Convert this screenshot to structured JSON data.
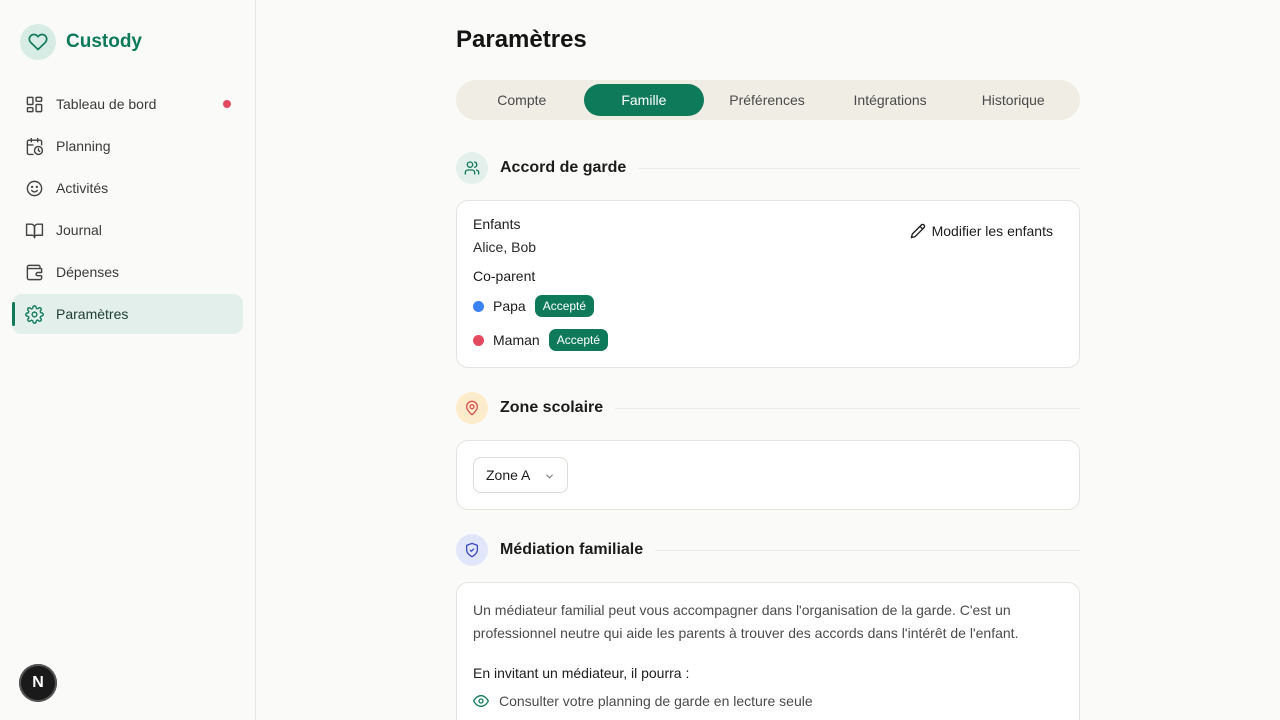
{
  "app": {
    "name": "Custody"
  },
  "sidebar": {
    "items": [
      {
        "label": "Tableau de bord",
        "icon": "dashboard-icon",
        "notification": true
      },
      {
        "label": "Planning",
        "icon": "calendar-clock-icon"
      },
      {
        "label": "Activités",
        "icon": "smile-icon"
      },
      {
        "label": "Journal",
        "icon": "book-icon"
      },
      {
        "label": "Dépenses",
        "icon": "wallet-icon"
      },
      {
        "label": "Paramètres",
        "icon": "gear-icon",
        "active": true
      }
    ],
    "user_initial": "N"
  },
  "page": {
    "title": "Paramètres"
  },
  "tabs": [
    {
      "label": "Compte"
    },
    {
      "label": "Famille",
      "active": true
    },
    {
      "label": "Préférences"
    },
    {
      "label": "Intégrations"
    },
    {
      "label": "Historique"
    }
  ],
  "custody": {
    "title": "Accord de garde",
    "children_label": "Enfants",
    "children_value": "Alice, Bob",
    "edit_label": "Modifier les enfants",
    "coparent_label": "Co-parent",
    "parents": [
      {
        "name": "Papa",
        "color": "#3b82f6",
        "status": "Accepté"
      },
      {
        "name": "Maman",
        "color": "#e34a5f",
        "status": "Accepté"
      }
    ]
  },
  "school_zone": {
    "title": "Zone scolaire",
    "selected": "Zone A"
  },
  "mediation": {
    "title": "Médiation familiale",
    "description": "Un médiateur familial peut vous accompagner dans l'organisation de la garde. C'est un professionnel neutre qui aide les parents à trouver des accords dans l'intérêt de l'enfant.",
    "subtitle": "En invitant un médiateur, il pourra :",
    "items": [
      {
        "label": "Consulter votre planning de garde en lecture seule",
        "icon": "eye-icon"
      }
    ]
  },
  "colors": {
    "accent": "#0f7a5a",
    "accent_light": "#e3efeb",
    "notification": "#e34a5f"
  }
}
